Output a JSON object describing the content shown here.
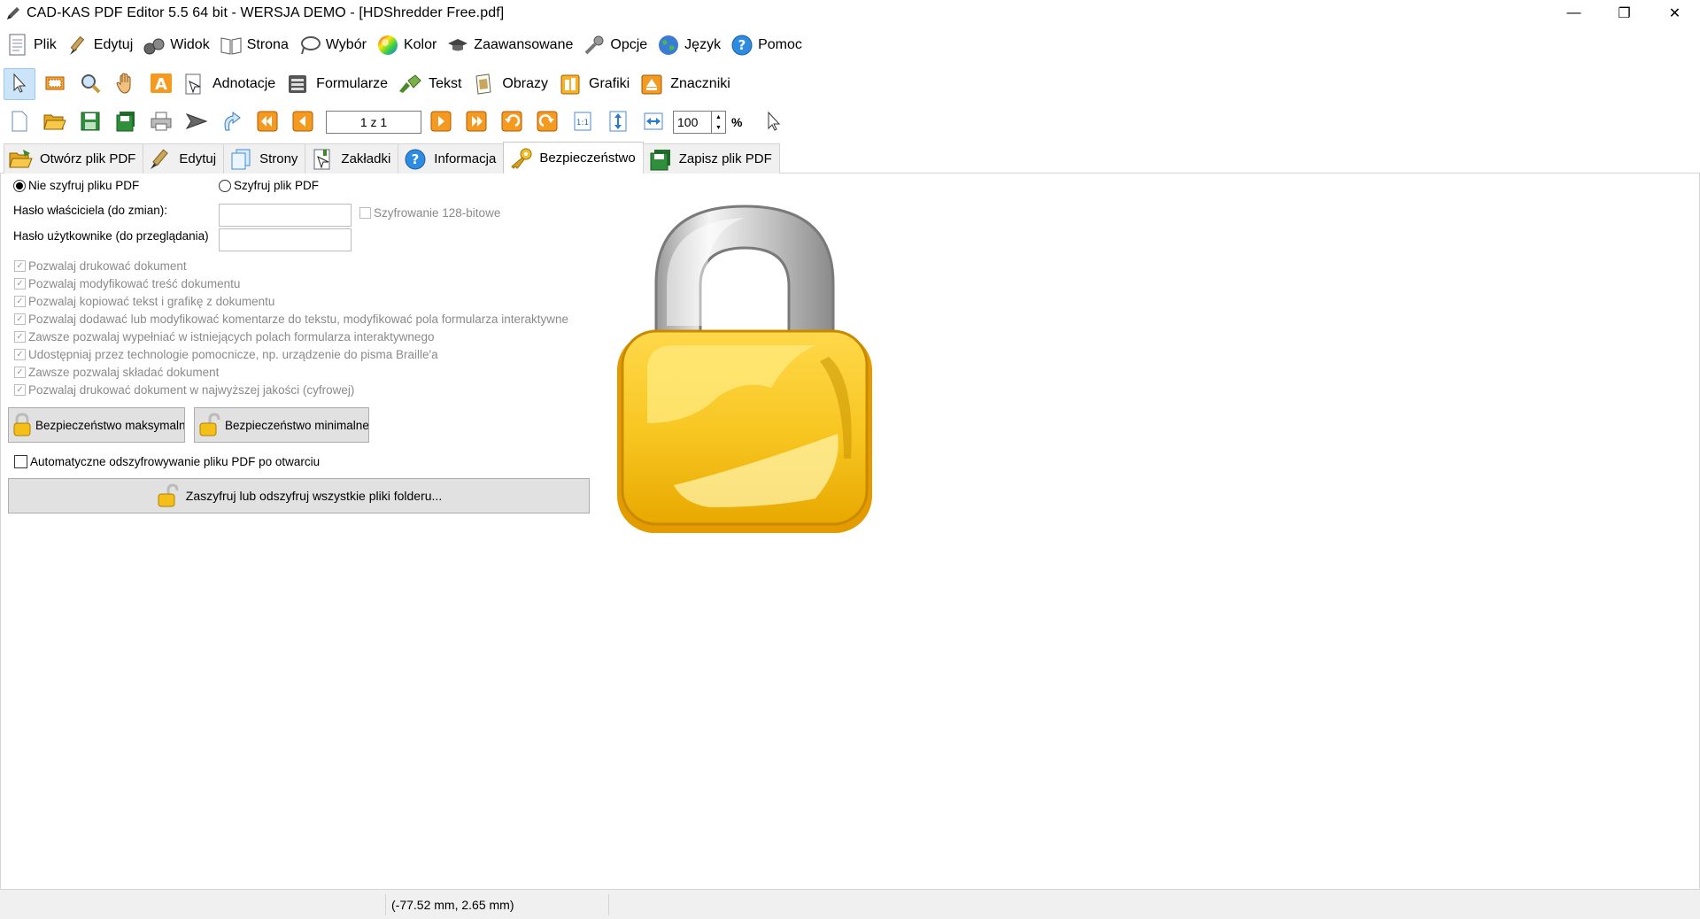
{
  "window": {
    "title": "CAD-KAS PDF Editor 5.5 64 bit - WERSJA DEMO - [HDShredder Free.pdf]",
    "minimize": "—",
    "maximize": "❐",
    "close": "✕"
  },
  "menu": [
    {
      "label": "Plik",
      "icon": "document-icon"
    },
    {
      "label": "Edytuj",
      "icon": "brush-icon"
    },
    {
      "label": "Widok",
      "icon": "binoculars-icon"
    },
    {
      "label": "Strona",
      "icon": "book-icon"
    },
    {
      "label": "Wybór",
      "icon": "lasso-icon"
    },
    {
      "label": "Kolor",
      "icon": "color-wheel-icon"
    },
    {
      "label": "Zaawansowane",
      "icon": "hat-icon"
    },
    {
      "label": "Opcje",
      "icon": "wrench-icon"
    },
    {
      "label": "Język",
      "icon": "globe-icon"
    },
    {
      "label": "Pomoc",
      "icon": "help-icon"
    }
  ],
  "toolbar1": {
    "adnotacje": "Adnotacje",
    "formularze": "Formularze",
    "tekst": "Tekst",
    "obrazy": "Obrazy",
    "grafiki": "Grafiki",
    "znaczniki": "Znaczniki"
  },
  "toolbar2": {
    "page_value": "1 z 1",
    "zoom_value": "100",
    "zoom_unit": "%",
    "one_to_one": "1:1"
  },
  "tabs": [
    {
      "label": "Otwórz plik PDF"
    },
    {
      "label": "Edytuj"
    },
    {
      "label": "Strony"
    },
    {
      "label": "Zakładki"
    },
    {
      "label": "Informacja"
    },
    {
      "label": "Bezpieczeństwo"
    },
    {
      "label": "Zapisz plik PDF"
    }
  ],
  "security": {
    "radio_no_encrypt": "Nie szyfruj pliku PDF",
    "radio_encrypt": "Szyfruj plik PDF",
    "owner_password_label": "Hasło właściciela (do zmian):",
    "user_password_label": "Hasło użytkownike (do przeglądania)",
    "encryption_128": "Szyfrowanie 128-bitowe",
    "permissions": [
      "Pozwalaj drukować dokument",
      "Pozwalaj modyfikować treść dokumentu",
      "Pozwalaj kopiować tekst i grafikę z dokumentu",
      "Pozwalaj dodawać lub modyfikować komentarze do tekstu, modyfikować pola formularza interaktywne",
      "Zawsze pozwalaj wypełniać w istniejących polach formularza interaktywnego",
      "Udostępniaj przez technologie pomocnicze, np. urządzenie do pisma Braille'a",
      "Zawsze pozwalaj składać dokument",
      "Pozwalaj drukować dokument w najwyższej jakości (cyfrowej)"
    ],
    "btn_max": "Bezpieczeństwo maksymalne",
    "btn_min": "Bezpieczeństwo minimalne",
    "auto_decrypt": "Automatyczne odszyfrowywanie pliku PDF po otwarciu",
    "folder_btn": "Zaszyfruj lub odszyfruj wszystkie pliki folderu..."
  },
  "status": {
    "coords": "(-77.52 mm, 2.65 mm)"
  },
  "colors": {
    "lock_gold": "#f7c520",
    "lock_shackle": "#d9d9d9",
    "selection_blue": "#cce4f7"
  }
}
